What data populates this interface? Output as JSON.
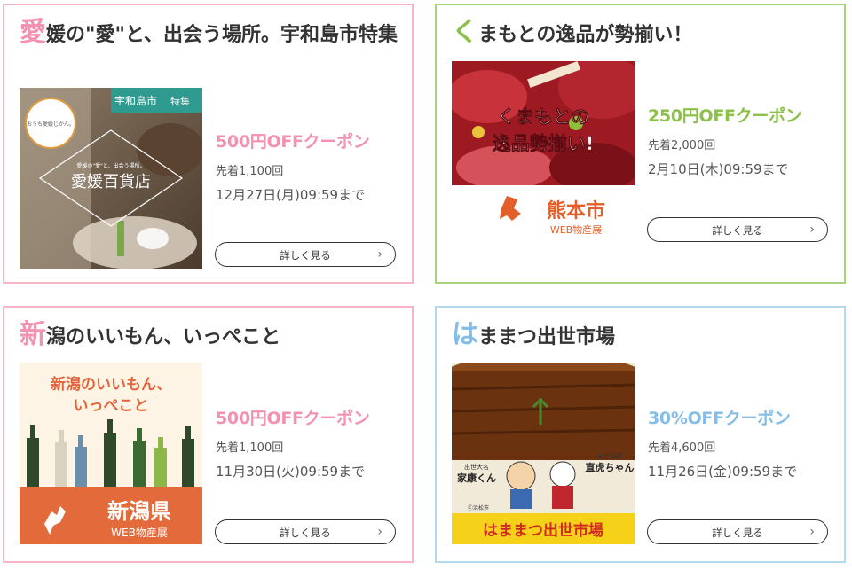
{
  "colors": {
    "pink": "#f7b5c7",
    "pink_text": "#f490b0",
    "green": "#a8d27e",
    "green_text": "#8cc04a",
    "blue": "#b3d8f0",
    "blue_text": "#84bde6"
  },
  "cards": [
    {
      "title_first": "愛",
      "title_rest": "媛の\"愛\"と、出会う場所。宇和島市特集",
      "image_text": {
        "tag_city": "宇和島市",
        "tag_feature": "特集",
        "badge": "おうち愛媛じかん。",
        "subtitle": "愛媛の\"愛\"と、出会う場所。",
        "store": "愛媛百貨店"
      },
      "coupon": "500円OFFクーポン",
      "count": "先着1,100回",
      "deadline": "12月27日(月)09:59まで",
      "button": "詳しく見る"
    },
    {
      "title_first": "く",
      "title_rest": "まもとの逸品が勢揃い！",
      "image_text": {
        "line1": "くまもとの",
        "line2": "逸品勢揃い!",
        "city": "熊本市",
        "expo": "WEB物産展"
      },
      "coupon": "250円OFFクーポン",
      "count": "先着2,000回",
      "deadline": "2月10日(木)09:59まで",
      "button": "詳しく見る"
    },
    {
      "title_first": "新",
      "title_rest": "潟のいいもん、いっぺこと",
      "image_text": {
        "line1": "新潟のいいもん、",
        "line2": "いっぺこと",
        "pref": "新潟県",
        "expo": "WEB物産展"
      },
      "coupon": "500円OFFクーポン",
      "count": "先着1,100回",
      "deadline": "11月30日(火)09:59まで",
      "button": "詳しく見る"
    },
    {
      "title_first": "は",
      "title_rest": "ままつ出世市場",
      "image_text": {
        "left_char": "家康くん",
        "left_label": "出世大名",
        "right_char": "直虎ちゃん",
        "right_label": "出世法師",
        "credit": "Ⓒ浜松市",
        "market": "はままつ出世市場"
      },
      "coupon": "30%OFFクーポン",
      "count": "先着4,600回",
      "deadline": "11月26日(金)09:59まで",
      "button": "詳しく見る"
    }
  ],
  "icons": {
    "chevron": "›"
  }
}
